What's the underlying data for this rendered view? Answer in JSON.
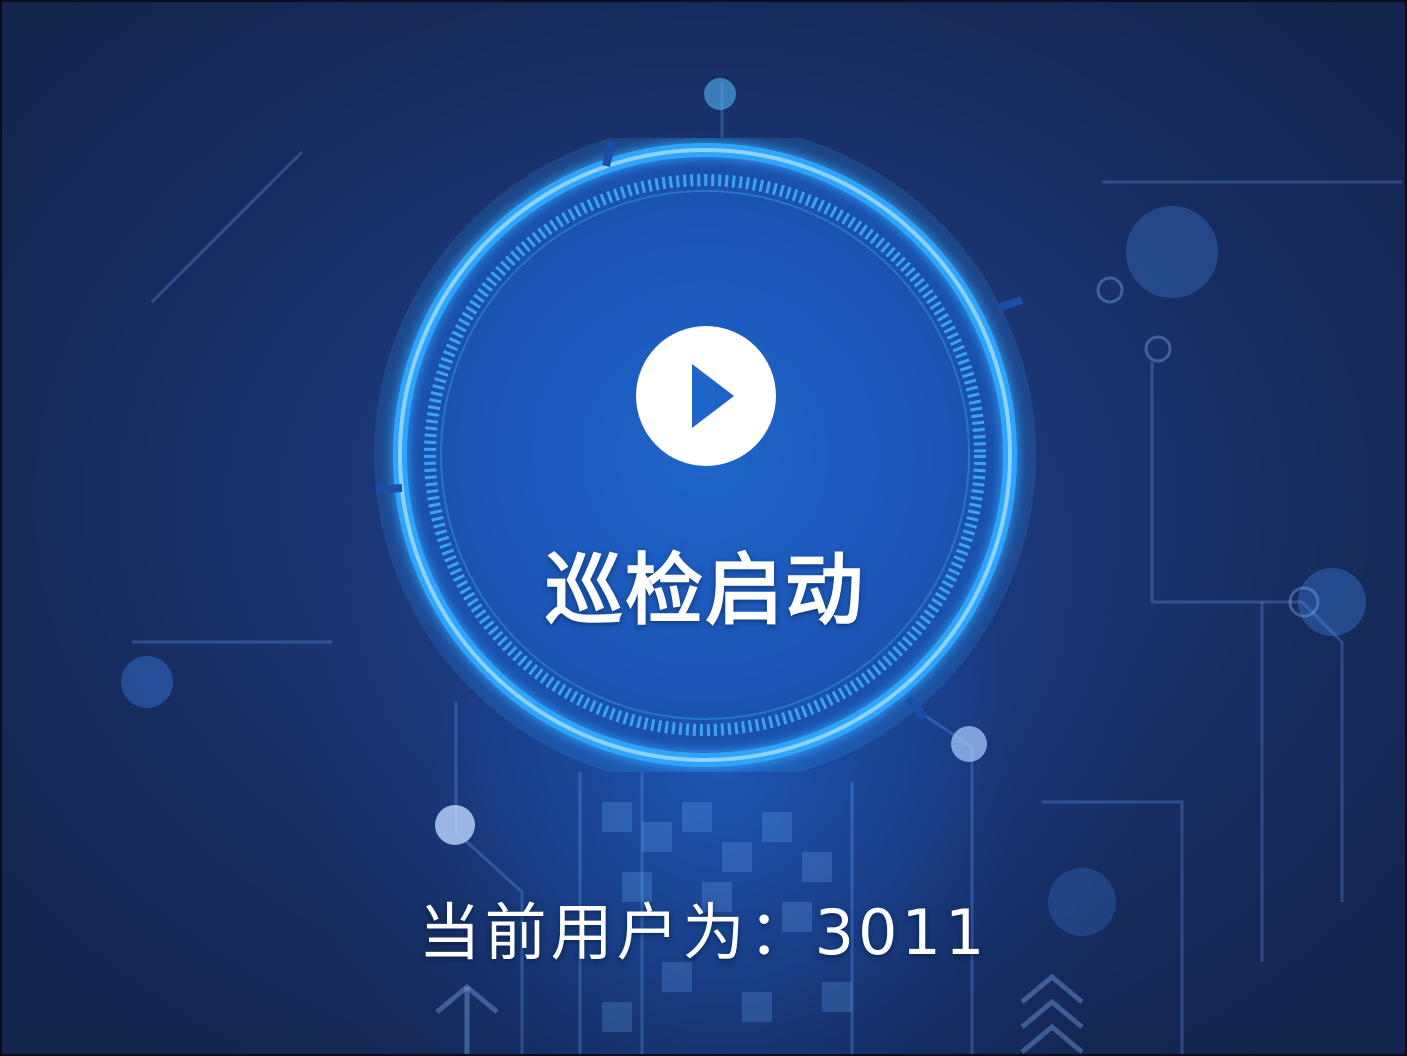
{
  "start_button": {
    "label": "巡检启动",
    "icon": "play-icon"
  },
  "user_status": {
    "prefix": "当前用户为：",
    "user_id": "3011"
  },
  "colors": {
    "background": "#1a3470",
    "ring": "#34a9ff",
    "text": "#ffffff",
    "play_triangle": "#1d63c8"
  }
}
